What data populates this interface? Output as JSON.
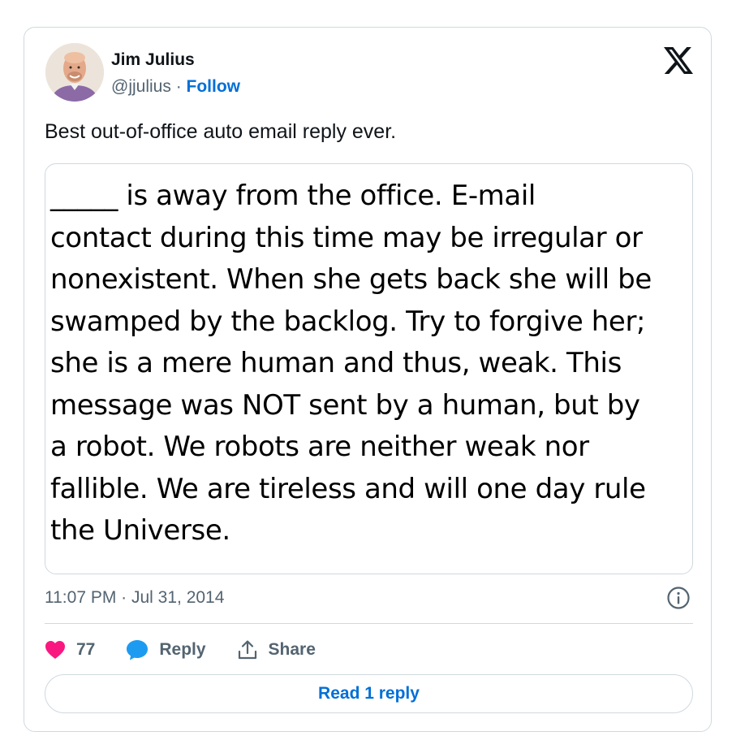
{
  "author": {
    "name": "Jim Julius",
    "handle": "@jjulius",
    "separator": "·",
    "follow_label": "Follow"
  },
  "tweet": {
    "text": "Best out-of-office auto email reply ever.",
    "image_text_lines": [
      "_____ is away from the office. E-mail",
      "contact during this time may be irregular or",
      "nonexistent. When she gets back she will be",
      "swamped by the backlog. Try to forgive her;",
      "she is a mere human and thus, weak. This",
      "message was NOT sent by a human, but by",
      "a robot. We robots are neither weak nor",
      "fallible. We are tireless and will one day rule",
      "the Universe."
    ],
    "timestamp": "11:07 PM · Jul 31, 2014"
  },
  "actions": {
    "like_count": "77",
    "reply_label": "Reply",
    "share_label": "Share"
  },
  "read_replies_label": "Read 1 reply",
  "icons": {
    "logo": "x-logo-icon",
    "info": "info-icon",
    "like": "heart-icon",
    "reply": "speech-bubble-icon",
    "share": "share-upload-icon"
  },
  "colors": {
    "link": "#006fd6",
    "muted": "#536471",
    "heart": "#f91880",
    "reply_bubble": "#1d9bf0",
    "border": "#cfd9de",
    "text": "#0f1419"
  }
}
